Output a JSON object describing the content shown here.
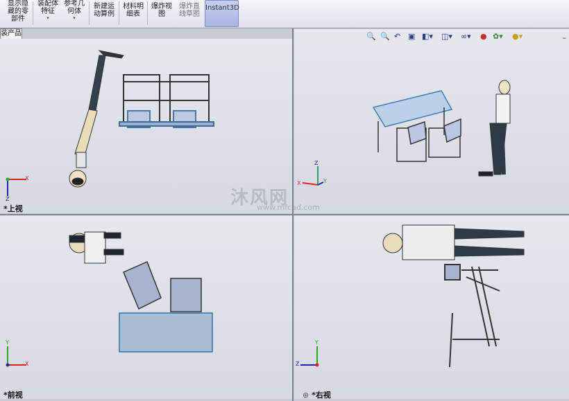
{
  "toolbar": {
    "buttons": [
      {
        "label_line1": "显示隐",
        "label_line2": "藏的零",
        "label_line3": "部件"
      },
      {
        "label_line1": "装配体",
        "label_line2": "特征"
      },
      {
        "label_line1": "参考几",
        "label_line2": "何体"
      },
      {
        "label_line1": "新建运",
        "label_line2": "动算例"
      },
      {
        "label_line1": "材料明",
        "label_line2": "细表"
      },
      {
        "label_line1": "爆炸视",
        "label_line2": "图"
      },
      {
        "label_line1": "爆炸直",
        "label_line2": "线草图"
      },
      {
        "label_line1": "Instant3D"
      }
    ]
  },
  "tree_tab": {
    "label": "装产品"
  },
  "viewports": {
    "top_left": {
      "label": "*上视",
      "triad": {
        "x": "X",
        "z": "Z"
      }
    },
    "top_right": {
      "label": "",
      "triad": {
        "x": "X",
        "y": "Y",
        "z": "Z"
      }
    },
    "bottom_left": {
      "label": "*前视",
      "triad": {
        "x": "X",
        "y": "Y"
      }
    },
    "bottom_right": {
      "label": "*右视",
      "triad": {
        "y": "Y",
        "z": "Z"
      }
    }
  },
  "watermark": {
    "text": "沐风网",
    "sub": "www.mfcad.com"
  },
  "heads_up_icons": [
    "zoom-fit-icon",
    "zoom-area-icon",
    "previous-view-icon",
    "section-view-icon",
    "view-orientation-icon",
    "display-style-icon",
    "hide-show-icon",
    "edit-appearance-icon",
    "apply-scene-icon",
    "view-settings-icon"
  ]
}
